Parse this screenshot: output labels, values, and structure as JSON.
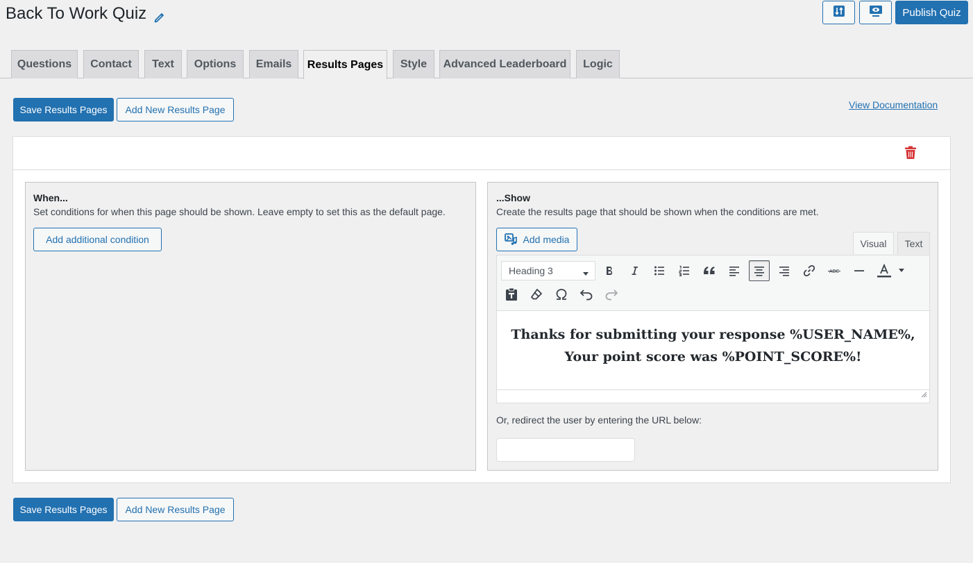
{
  "header": {
    "title": "Back To Work Quiz",
    "publish_label": "Publish Quiz",
    "accent": "#2271b1"
  },
  "tabs": [
    {
      "label": "Questions"
    },
    {
      "label": "Contact"
    },
    {
      "label": "Text"
    },
    {
      "label": "Options"
    },
    {
      "label": "Emails"
    },
    {
      "label": "Results Pages",
      "active": true
    },
    {
      "label": "Style"
    },
    {
      "label": "Advanced Leaderboard"
    },
    {
      "label": "Logic"
    }
  ],
  "actions": {
    "save_label": "Save Results Pages",
    "add_label": "Add New Results Page",
    "doc_link": "View Documentation"
  },
  "when_panel": {
    "title": "When...",
    "description": "Set conditions for when this page should be shown. Leave empty to set this as the default page.",
    "add_condition_label": "Add additional condition"
  },
  "show_panel": {
    "title": "...Show",
    "description": "Create the results page that should be shown when the conditions are met.",
    "add_media_label": "Add media",
    "editor_tabs": {
      "visual": "Visual",
      "text": "Text",
      "active": "Visual"
    },
    "format_select": "Heading 3",
    "toolbar_icons": [
      "bold-icon",
      "italic-icon",
      "bullet-list-icon",
      "numbered-list-icon",
      "blockquote-icon",
      "align-left-icon",
      "align-center-icon",
      "align-right-icon",
      "link-icon",
      "strikethrough-icon",
      "horizontal-line-icon",
      "text-color-icon",
      "paste-text-icon",
      "clear-formatting-icon",
      "special-character-icon",
      "undo-icon",
      "redo-icon"
    ],
    "content_line1": "Thanks for submitting your response %USER_NAME%,",
    "content_line2": "Your point score was %POINT_SCORE%!",
    "redirect_label": "Or, redirect the user by entering the URL below:",
    "redirect_value": ""
  },
  "colors": {
    "danger": "#d63638",
    "background": "#f0f0f1"
  }
}
